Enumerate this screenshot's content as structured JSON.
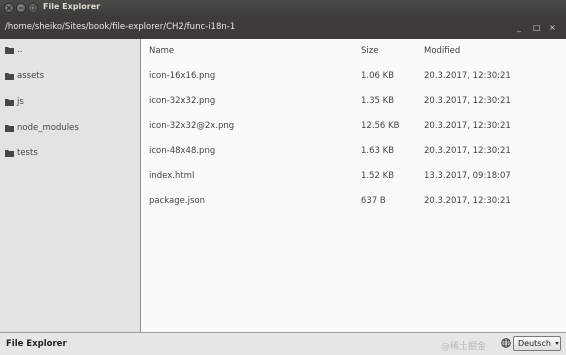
{
  "window": {
    "title": "File Explorer",
    "path": "/home/sheiko/Sites/book/file-explorer/CH2/func-i18n-1"
  },
  "sidebar": {
    "items": [
      {
        "label": ".."
      },
      {
        "label": "assets"
      },
      {
        "label": "js"
      },
      {
        "label": "node_modules"
      },
      {
        "label": "tests"
      }
    ]
  },
  "table": {
    "headers": {
      "name": "Name",
      "size": "Size",
      "modified": "Modified"
    },
    "rows": [
      {
        "name": "icon-16x16.png",
        "size": "1.06 KB",
        "modified": "20.3.2017, 12:30:21"
      },
      {
        "name": "icon-32x32.png",
        "size": "1.35 KB",
        "modified": "20.3.2017, 12:30:21"
      },
      {
        "name": "icon-32x32@2x.png",
        "size": "12.56 KB",
        "modified": "20.3.2017, 12:30:21"
      },
      {
        "name": "icon-48x48.png",
        "size": "1.63 KB",
        "modified": "20.3.2017, 12:30:21"
      },
      {
        "name": "index.html",
        "size": "1.52 KB",
        "modified": "13.3.2017, 09:18:07"
      },
      {
        "name": "package.json",
        "size": "637 B",
        "modified": "20.3.2017, 12:30:21"
      }
    ]
  },
  "statusbar": {
    "title": "File Explorer",
    "watermark": "@稀土掘金",
    "language": "Deutsch"
  },
  "icons": {
    "folder": "folder-icon",
    "globe": "globe-icon",
    "close": "close-icon",
    "minimize": "minimize-icon",
    "maximize": "maximize-icon"
  },
  "colors": {
    "titlebar": "#3b3b37",
    "pathbar": "#3c3b37",
    "sidebar": "#e3e3e3",
    "main": "#fafafa",
    "statusbar": "#e6e6e6"
  }
}
